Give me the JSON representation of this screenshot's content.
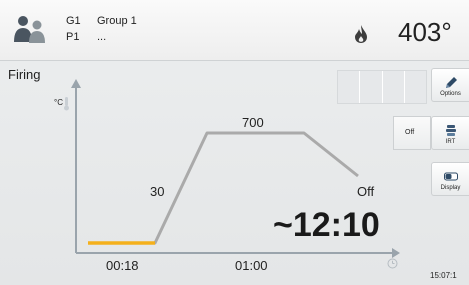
{
  "header": {
    "group_code": "G1",
    "group_name": "Group 1",
    "program_code": "P1",
    "program_name": "...",
    "temperature": "403°"
  },
  "mode_title": "Firing",
  "buttons": {
    "options_label": "Options",
    "irt_state": "Off",
    "irt_label": "IRT",
    "display_label": "Display"
  },
  "firing_curve": {
    "y_unit": "°C",
    "hold_temperature": "700",
    "heat_rate": "30",
    "cooling": "Off",
    "remaining_time": "~12:10",
    "x_ticks": [
      "00:18",
      "01:00"
    ],
    "elapsed_fraction": 0.13
  },
  "status": {
    "clock": "15:07:1"
  },
  "colors": {
    "curve": "#aaaaaa",
    "progress": "#f4b01c",
    "axis": "#9aa4ac"
  }
}
